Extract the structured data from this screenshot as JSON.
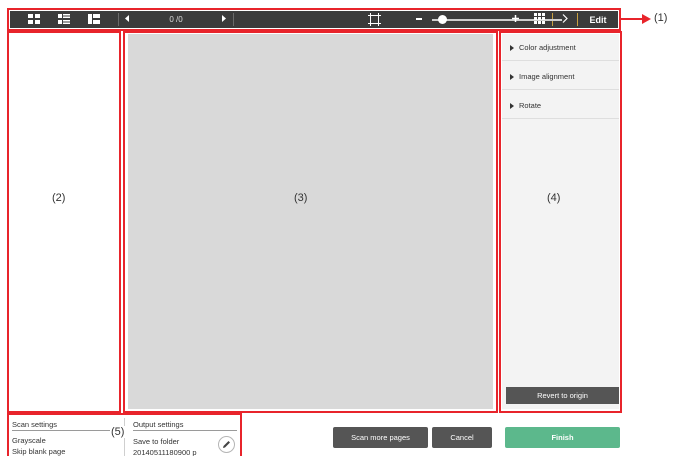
{
  "toolbar": {
    "page_counter": "0 /0",
    "edit_label": "Edit",
    "zoom_fraction": 0.08,
    "background": "#3b3b3b"
  },
  "edit_panel": {
    "items": [
      {
        "label": "Color adjustment"
      },
      {
        "label": "Image alignment"
      },
      {
        "label": "Rotate"
      }
    ],
    "revert_label": "Revert to origin"
  },
  "buttons": {
    "scan_more": "Scan more pages",
    "cancel": "Cancel",
    "finish": "Finish"
  },
  "scan_settings": {
    "title": "Scan settings",
    "color_mode": "Grayscale",
    "blank_page": "Skip blank page"
  },
  "output_settings": {
    "title": "Output settings",
    "destination": "Save to folder",
    "filename": "20140511180900 p"
  },
  "callouts": {
    "toolbar": "(1)",
    "thumbnails": "(2)",
    "preview": "(3)",
    "edit": "(4)",
    "settings": "(5)"
  },
  "colors": {
    "highlight": "#e8242b",
    "finish": "#5cb88c",
    "dark_button": "#555555"
  }
}
